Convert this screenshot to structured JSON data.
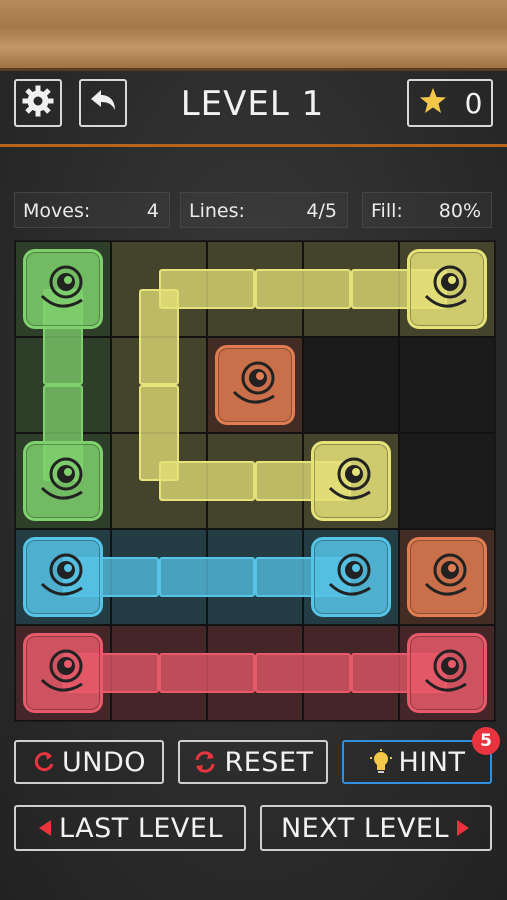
{
  "header": {
    "level_title": "LEVEL 1",
    "star_count": "0",
    "settings_icon": "gear-icon",
    "back_icon": "back-arrow-icon",
    "star_icon": "star-icon"
  },
  "stats": {
    "moves_label": "Moves:",
    "moves_value": "4",
    "lines_label": "Lines:",
    "lines_value": "4/5",
    "fill_label": "Fill:",
    "fill_value": "80%"
  },
  "grid": {
    "rows": 5,
    "cols": 5,
    "colors": {
      "green": "#7fd16d",
      "yellow": "#e6e27a",
      "orange": "#e07d52",
      "blue": "#56c4e6",
      "red": "#e85a6a"
    },
    "flows": [
      {
        "color": "green",
        "cells": [
          [
            0,
            0
          ],
          [
            1,
            0
          ],
          [
            2,
            0
          ]
        ]
      },
      {
        "color": "yellow",
        "cells": [
          [
            0,
            4
          ],
          [
            0,
            3
          ],
          [
            0,
            2
          ],
          [
            0,
            1
          ],
          [
            1,
            1
          ],
          [
            2,
            1
          ],
          [
            2,
            2
          ],
          [
            2,
            3
          ]
        ]
      },
      {
        "color": "orange",
        "cells": [
          [
            1,
            2
          ]
        ]
      },
      {
        "color": "orange",
        "cells": [
          [
            3,
            4
          ]
        ]
      },
      {
        "color": "blue",
        "cells": [
          [
            3,
            0
          ],
          [
            3,
            1
          ],
          [
            3,
            2
          ],
          [
            3,
            3
          ]
        ]
      },
      {
        "color": "red",
        "cells": [
          [
            4,
            0
          ],
          [
            4,
            1
          ],
          [
            4,
            2
          ],
          [
            4,
            3
          ],
          [
            4,
            4
          ]
        ]
      }
    ]
  },
  "buttons": {
    "undo_label": "UNDO",
    "reset_label": "RESET",
    "hint_label": "HINT",
    "hint_badge": "5",
    "last_level_label": "LAST LEVEL",
    "next_level_label": "NEXT LEVEL",
    "undo_icon": "undo-icon",
    "reset_icon": "reset-icon",
    "hint_icon": "lightbulb-icon",
    "prev_icon": "triangle-left-icon",
    "next_icon": "triangle-right-icon",
    "accent_red": "#e8343f",
    "accent_blue": "#2f8fe0",
    "accent_yellow": "#f3c84a"
  }
}
